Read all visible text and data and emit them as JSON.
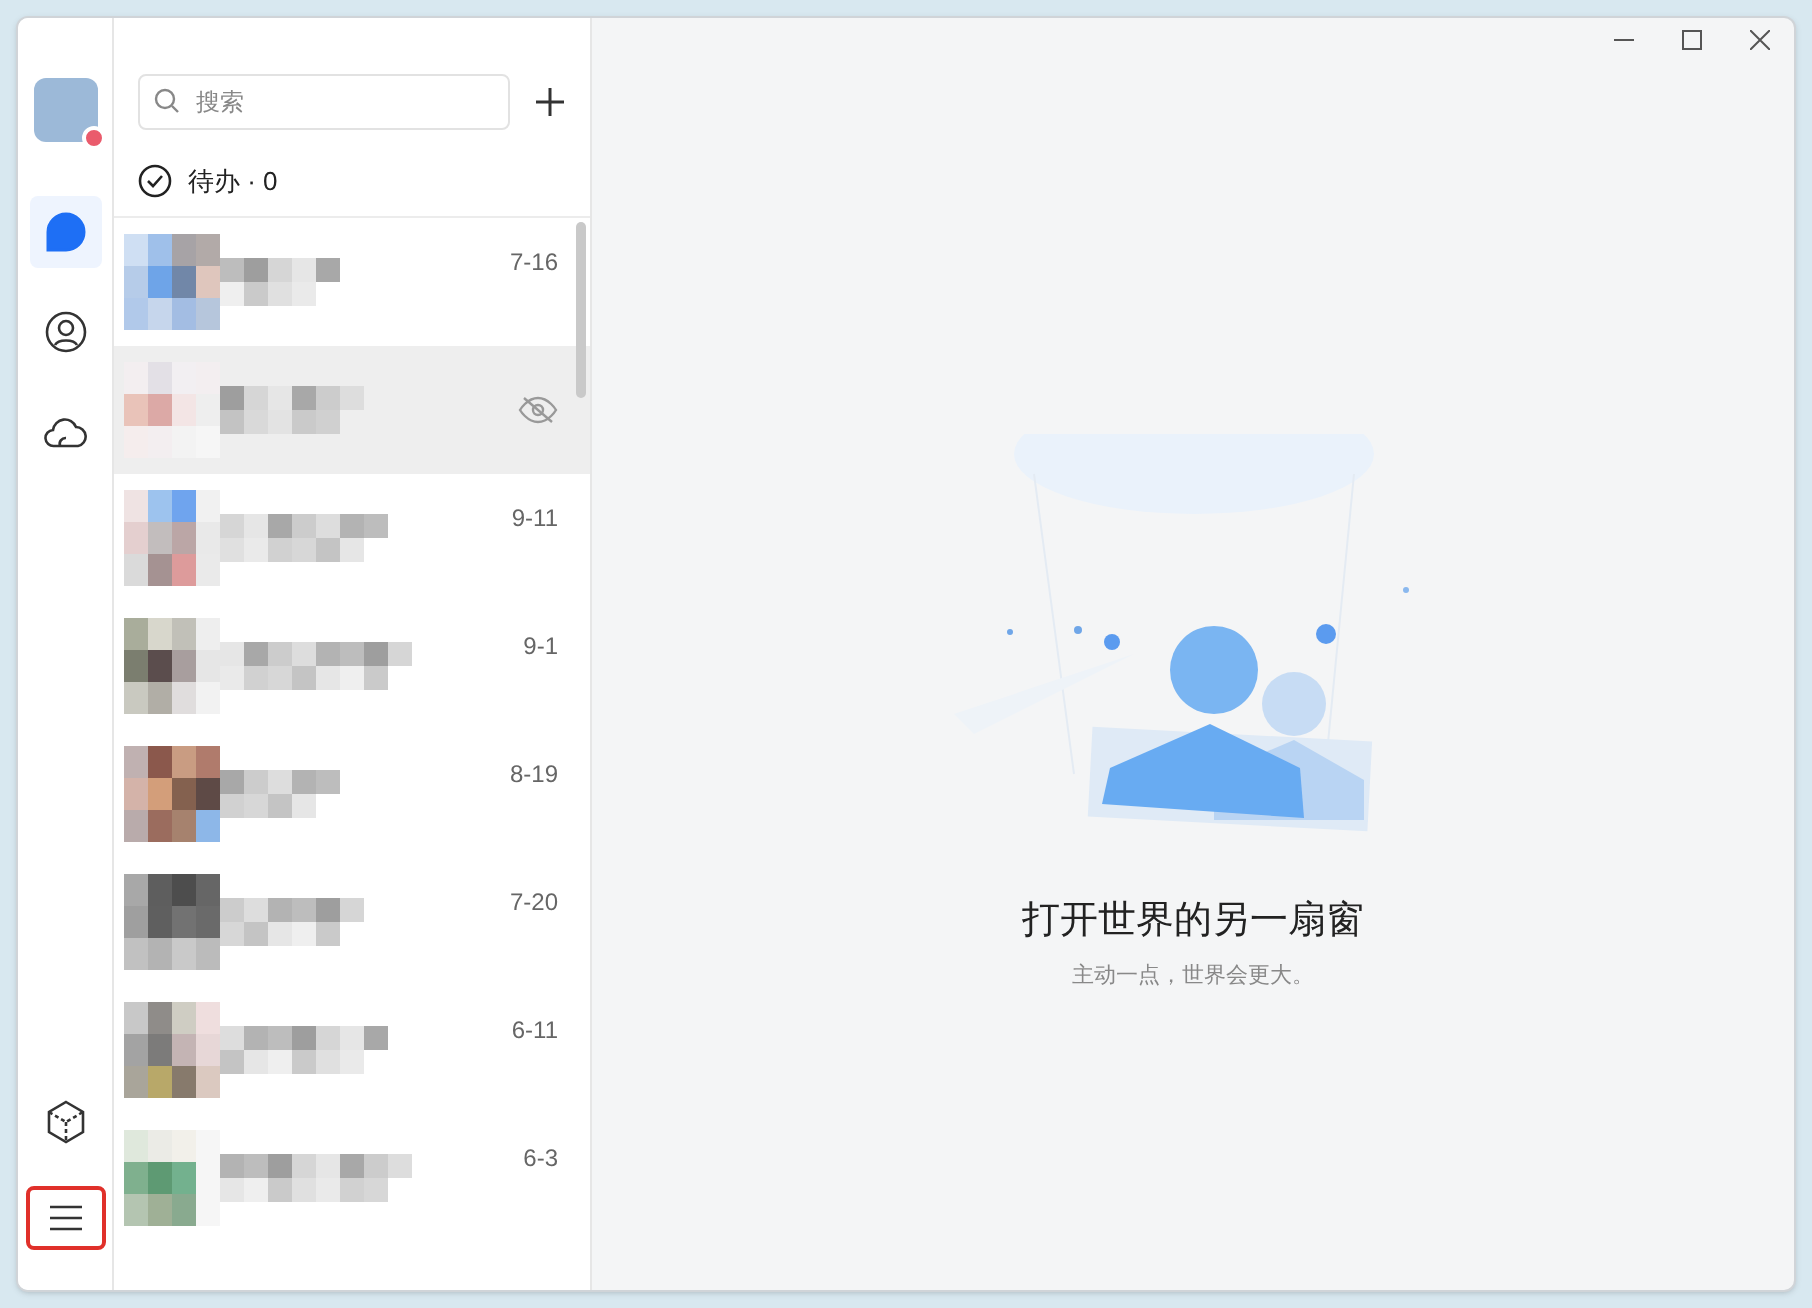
{
  "nav": {
    "items": [
      {
        "kind": "chat",
        "selected": true
      },
      {
        "kind": "contacts",
        "selected": false
      },
      {
        "kind": "cloud",
        "selected": false
      }
    ],
    "bottom": [
      {
        "kind": "apps",
        "highlighted": false
      },
      {
        "kind": "menu",
        "highlighted": true
      }
    ]
  },
  "search": {
    "placeholder": "搜索"
  },
  "todo": {
    "label": "待办 · 0"
  },
  "chats": [
    {
      "kind": "date",
      "date": "7-16",
      "selected": false
    },
    {
      "kind": "hidden",
      "selected": true
    },
    {
      "kind": "date",
      "date": "9-11",
      "selected": false
    },
    {
      "kind": "date",
      "date": "9-1",
      "selected": false
    },
    {
      "kind": "date",
      "date": "8-19",
      "selected": false
    },
    {
      "kind": "date",
      "date": "7-20",
      "selected": false
    },
    {
      "kind": "date",
      "date": "6-11",
      "selected": false
    },
    {
      "kind": "date",
      "date": "6-3",
      "selected": false
    }
  ],
  "empty": {
    "title": "打开世界的另一扇窗",
    "subtitle": "主动一点，世界会更大。"
  }
}
